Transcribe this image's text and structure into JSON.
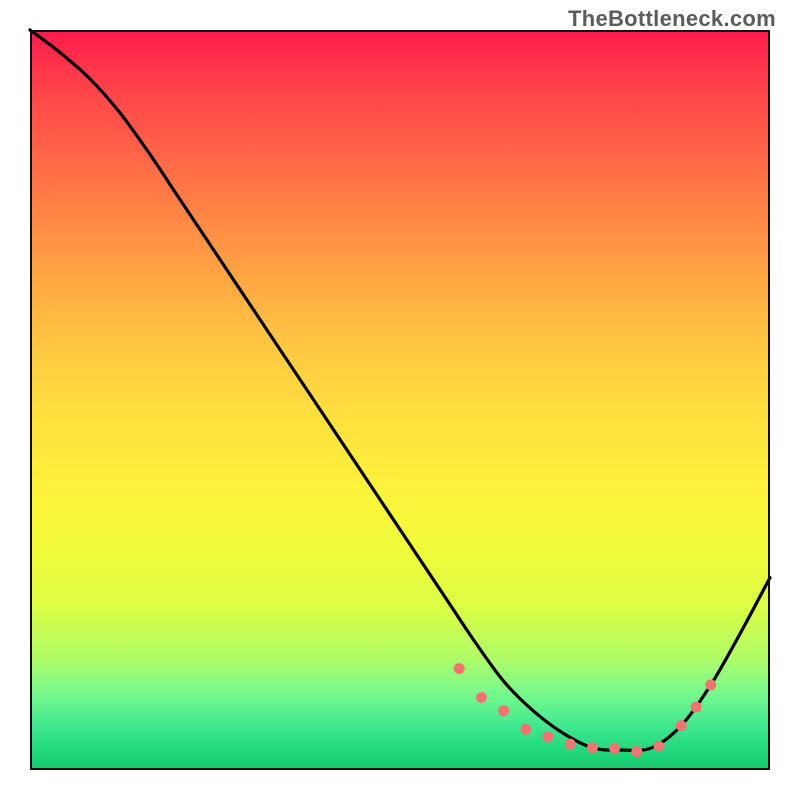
{
  "attribution": "TheBottleneck.com",
  "chart_data": {
    "type": "line",
    "title": "",
    "xlabel": "",
    "ylabel": "",
    "xlim": [
      0,
      100
    ],
    "ylim": [
      0,
      100
    ],
    "grid": false,
    "legend": false,
    "annotations": [],
    "series": [
      {
        "name": "curve",
        "x": [
          0,
          4,
          8,
          12,
          16,
          20,
          24,
          28,
          32,
          36,
          40,
          44,
          48,
          52,
          56,
          60,
          64,
          68,
          72,
          76,
          80,
          84,
          88,
          92,
          96,
          100
        ],
        "values": [
          100,
          97,
          93.5,
          89,
          83.5,
          77.5,
          71.5,
          65.5,
          59.5,
          53.5,
          47.5,
          41.5,
          35.5,
          29.5,
          23.5,
          17.5,
          12,
          8,
          5,
          3,
          2.7,
          3,
          6,
          11.5,
          18.5,
          26
        ],
        "color": "#000000"
      }
    ],
    "markers": {
      "name": "highlight-dots",
      "x": [
        58,
        61,
        64,
        67,
        70,
        73,
        76,
        79,
        82,
        85,
        88,
        90,
        92
      ],
      "values": [
        13.7,
        9.8,
        8,
        5.5,
        4.5,
        3.5,
        3,
        2.9,
        2.5,
        3.2,
        6,
        8.5,
        11.5
      ],
      "color": "#ef7570",
      "size": 11
    },
    "background_gradient_stops": [
      {
        "pos": 0.0,
        "color": "#ff1a4c"
      },
      {
        "pos": 0.3,
        "color": "#ff9944"
      },
      {
        "pos": 0.6,
        "color": "#fdf23c"
      },
      {
        "pos": 0.85,
        "color": "#aefc69"
      },
      {
        "pos": 1.0,
        "color": "#16c96c"
      }
    ]
  }
}
